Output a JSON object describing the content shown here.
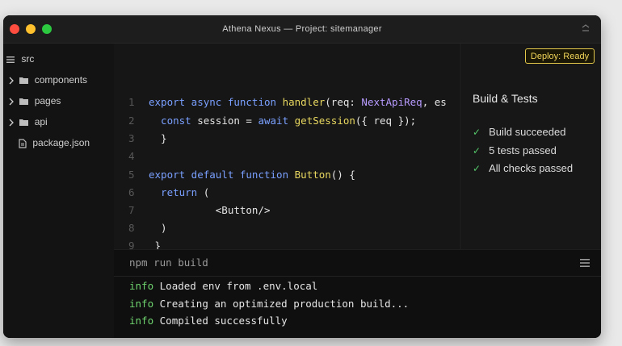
{
  "window": {
    "title": "Athena Nexus — Project: sitemanager"
  },
  "sidebar": {
    "root": "src",
    "items": [
      {
        "label": "components",
        "type": "folder"
      },
      {
        "label": "pages",
        "type": "folder"
      },
      {
        "label": "api",
        "type": "folder"
      },
      {
        "label": "package.json",
        "type": "file"
      }
    ]
  },
  "editor": {
    "lines": [
      {
        "num": "1",
        "parts": [
          {
            "t": "export async function ",
            "c": "kw"
          },
          {
            "t": "handler",
            "c": "fn"
          },
          {
            "t": "(req: ",
            "c": ""
          },
          {
            "t": "NextApiReq",
            "c": "ty"
          },
          {
            "t": ", es",
            "c": ""
          }
        ]
      },
      {
        "num": "2",
        "parts": [
          {
            "t": "  const ",
            "c": "kw"
          },
          {
            "t": "session = ",
            "c": ""
          },
          {
            "t": "await ",
            "c": "kw"
          },
          {
            "t": "getSession",
            "c": "fn"
          },
          {
            "t": "({ req });",
            "c": ""
          }
        ]
      },
      {
        "num": "3",
        "parts": [
          {
            "t": "  }",
            "c": ""
          }
        ]
      },
      {
        "num": "4",
        "parts": []
      },
      {
        "num": "5",
        "parts": [
          {
            "t": "export default function ",
            "c": "kw"
          },
          {
            "t": "Button",
            "c": "fn"
          },
          {
            "t": "() {",
            "c": ""
          }
        ]
      },
      {
        "num": "6",
        "parts": [
          {
            "t": "  return ",
            "c": "kw"
          },
          {
            "t": "(",
            "c": ""
          }
        ]
      },
      {
        "num": "7",
        "parts": [
          {
            "t": "           <Button/>",
            "c": ""
          }
        ]
      },
      {
        "num": "8",
        "parts": [
          {
            "t": "  )",
            "c": ""
          }
        ]
      },
      {
        "num": "9",
        "parts": [
          {
            "t": " }",
            "c": ""
          }
        ]
      }
    ]
  },
  "deploy_badge": "Deploy: Ready",
  "build_tests": {
    "title": "Build & Tests",
    "items": [
      "Build succeeded",
      "5 tests passed",
      "All checks passed"
    ]
  },
  "terminal": {
    "command": "npm run build",
    "lines": [
      {
        "level": "info",
        "text": "Loaded env from .env.local"
      },
      {
        "level": "info",
        "text": "Creating an optimized production build..."
      },
      {
        "level": "info",
        "text": "Compiled successfully"
      }
    ]
  },
  "colors": {
    "traffic_red": "#ff4d40",
    "traffic_yellow": "#ffc02e",
    "traffic_green": "#2bc840",
    "badge": "#f0d458",
    "check": "#54c76a",
    "info": "#6fd46f"
  }
}
